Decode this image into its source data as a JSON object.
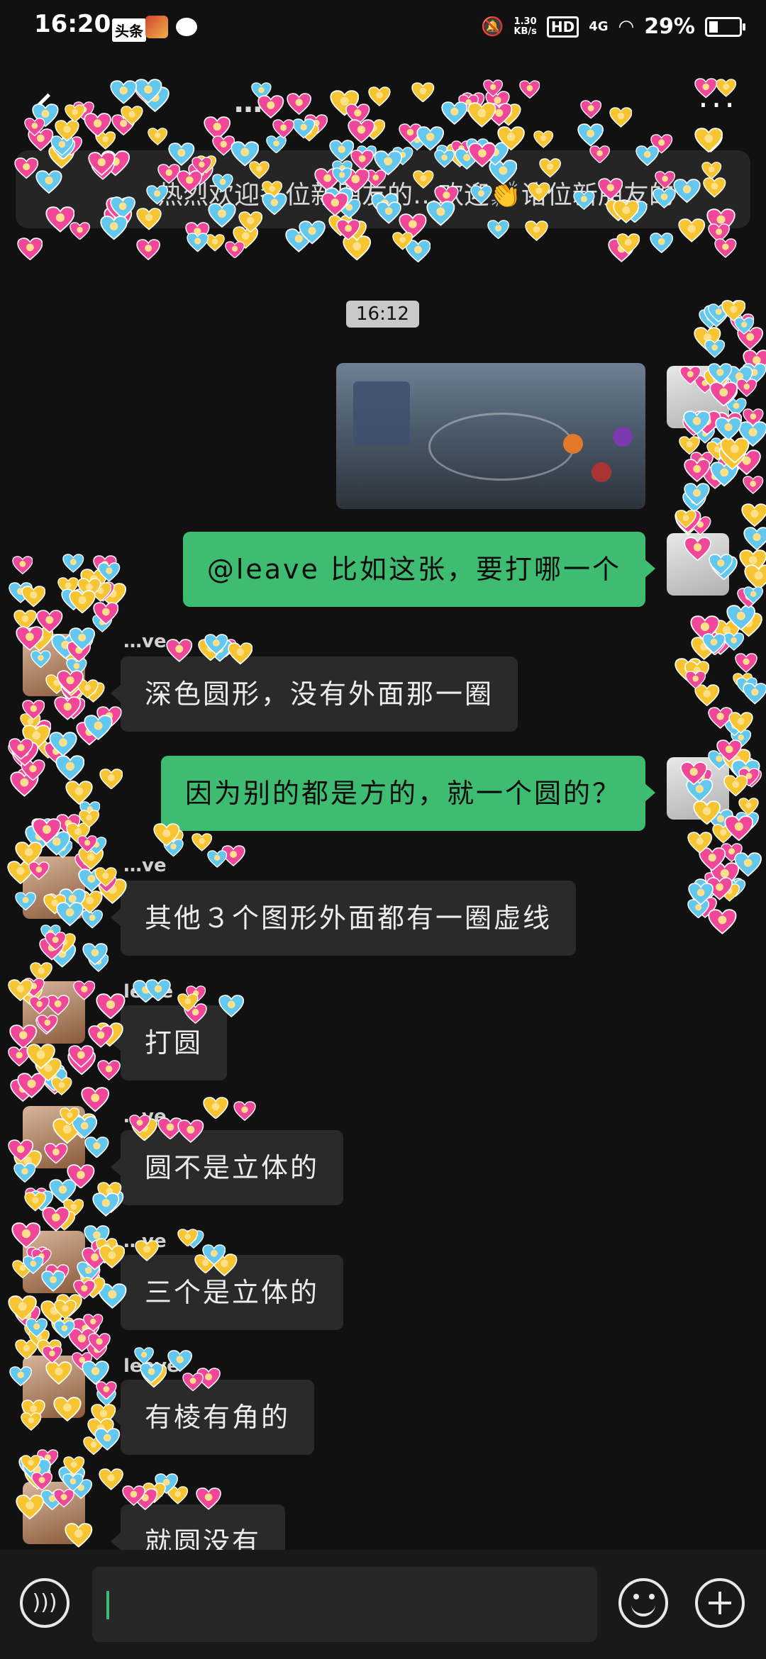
{
  "status_bar": {
    "time": "16:20",
    "news_badge": "头条",
    "net_speed_value": "1.30",
    "net_speed_unit": "KB/s",
    "hd": "HD",
    "signal": "4G",
    "battery": "29%",
    "battery_level": 0.29
  },
  "header": {
    "title": "…"
  },
  "notice": {
    "text": "热烈欢迎各位新朋友的…欢迎👏诸位新朋友的"
  },
  "chat": {
    "timestamp": "16:12",
    "messages": [
      {
        "side": "me",
        "text": "@leave 比如这张，要打哪一个"
      },
      {
        "side": "other",
        "sender": "…ve",
        "text": "深色圆形，没有外面那一圈"
      },
      {
        "side": "me",
        "text": "因为别的都是方的，就一个圆的？"
      },
      {
        "side": "other",
        "sender": "…ve",
        "text": "其他３个图形外面都有一圈虚线"
      },
      {
        "side": "other",
        "sender": "le…e",
        "text": "打圆"
      },
      {
        "side": "other",
        "sender": "…ve",
        "text": "圆不是立体的"
      },
      {
        "side": "other",
        "sender": "…ve",
        "text": "三个是立体的"
      },
      {
        "side": "other",
        "sender": "leave",
        "text": "有棱有角的"
      },
      {
        "side": "other",
        "sender": "…ave",
        "text": "就圆没有"
      }
    ]
  },
  "input": {
    "placeholder": ""
  },
  "colors": {
    "background": "#111111",
    "my_bubble": "#3ebd72",
    "other_bubble": "#2a2a2a",
    "heart_pink": "#f0479a",
    "heart_yellow": "#f7c531",
    "heart_blue": "#63c8f0"
  },
  "icons": {
    "back": "chevron-left-icon",
    "more": "more-dots-icon",
    "voice": "voice-icon",
    "emoji": "emoji-icon",
    "plus": "plus-icon"
  }
}
